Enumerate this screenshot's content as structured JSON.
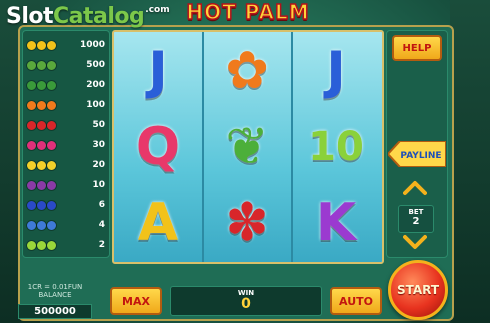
{
  "watermark": {
    "slot": "Slot",
    "catalog": "Catalog",
    "domain": ".com"
  },
  "title": "HOT PALM",
  "paytable": [
    {
      "value": "1000",
      "icon": "palm-tree-3x",
      "color": "#f2c21a"
    },
    {
      "value": "500",
      "icon": "pineapple-3x",
      "color": "#5aa83c"
    },
    {
      "value": "200",
      "icon": "parrot-3x",
      "color": "#3a9a3a"
    },
    {
      "value": "100",
      "icon": "bird-of-paradise-3x",
      "color": "#f07a1c"
    },
    {
      "value": "50",
      "icon": "hibiscus-3x",
      "color": "#d8262a"
    },
    {
      "value": "30",
      "icon": "dragon-fruit-3x",
      "color": "#e0307a"
    },
    {
      "value": "20",
      "icon": "banana-3x",
      "color": "#f2d02a"
    },
    {
      "value": "10",
      "icon": "mangosteen-3x",
      "color": "#8a3aa6"
    },
    {
      "value": "6",
      "icon": "blueberry-3x",
      "color": "#2a4ac8"
    },
    {
      "value": "4",
      "icon": "passion-fruit-3x",
      "color": "#3f7ad8"
    },
    {
      "value": "2",
      "icon": "1000-coins-3x",
      "color": "#9ad63a"
    }
  ],
  "reels": [
    [
      {
        "name": "letter-j-symbol",
        "text": "J",
        "color": "#2a5fd8"
      },
      {
        "name": "letter-q-symbol",
        "text": "Q",
        "color": "#e8386a"
      },
      {
        "name": "letter-a-symbol",
        "text": "A",
        "color": "#f2c21a"
      }
    ],
    [
      {
        "name": "bird-of-paradise-symbol",
        "text": "✿",
        "color": "#f07a1c"
      },
      {
        "name": "parrot-symbol",
        "text": "❦",
        "color": "#4caf3a"
      },
      {
        "name": "hibiscus-symbol",
        "text": "✽",
        "color": "#d8262a"
      }
    ],
    [
      {
        "name": "letter-j-symbol",
        "text": "J",
        "color": "#2a5fd8"
      },
      {
        "name": "number-10-symbol",
        "text": "10",
        "color": "#8ad13a"
      },
      {
        "name": "letter-k-symbol",
        "text": "K",
        "color": "#9b3ad0"
      }
    ]
  ],
  "buttons": {
    "help": "HELP",
    "payline": "PAYLINE",
    "max": "MAX",
    "auto": "AUTO",
    "start": "START"
  },
  "bet": {
    "label": "BET",
    "value": "2"
  },
  "info": {
    "rate": "1CR = 0.01FUN",
    "balance_label": "BALANCE",
    "balance": "500000"
  },
  "win": {
    "label": "WIN",
    "value": "0"
  }
}
